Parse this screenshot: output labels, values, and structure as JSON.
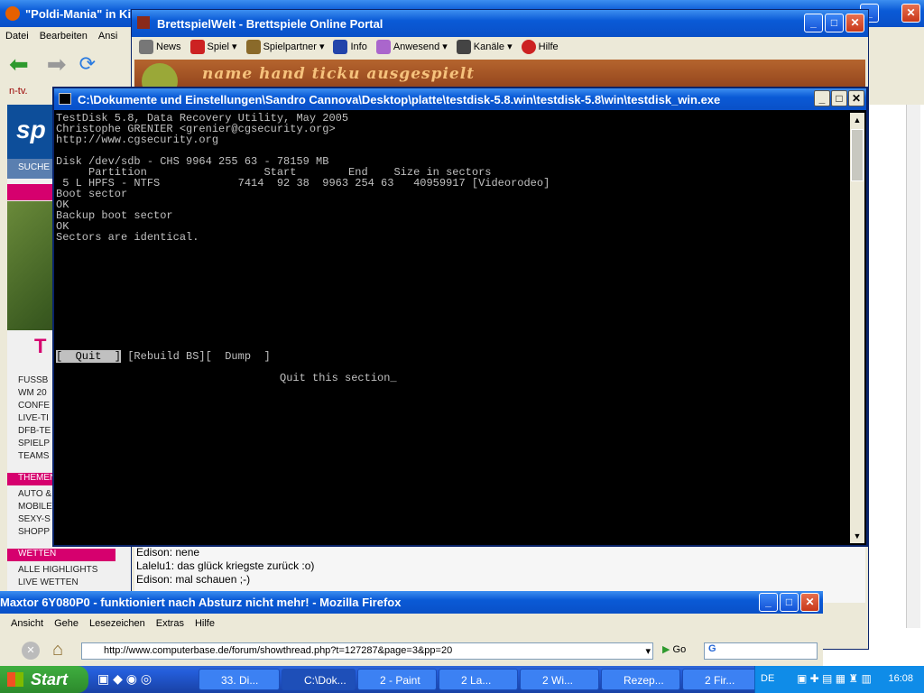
{
  "firefox_back": {
    "title": "\"Poldi-Mania\" in Ki",
    "menu": [
      "Datei",
      "Bearbeiten",
      "Ansi"
    ],
    "bookmark": "n-tv.",
    "sidebar_items": [
      "FUSSB",
      "WM 20",
      "CONFE",
      "LIVE-TI",
      "DFB-TE",
      "SPIELP",
      "TEAMS"
    ],
    "sidebar_themen": "THEMEN",
    "sidebar_items2": [
      "AUTO &",
      "MOBILE",
      "SEXY-S",
      "SHOPP"
    ],
    "wetten": "WETTEN",
    "sidebar_items3": [
      "ALLE HIGHLIGHTS",
      "LIVE WETTEN"
    ],
    "suche": "SUCHE"
  },
  "brettspielwelt": {
    "title": "BrettspielWelt - Brettspiele Online Portal",
    "toolbar": [
      "News",
      "Spiel",
      "Spielpartner",
      "Info",
      "Anwesend",
      "Kanäle",
      "Hilfe"
    ],
    "banner": "name   hand  ticku  ausgespielt",
    "chat": [
      "Edison: nene",
      "Lalelu1: das glück kriegste zurück :o)",
      "Edison: mal schauen ;-)"
    ]
  },
  "testdisk": {
    "title": "C:\\Dokumente und Einstellungen\\Sandro Cannova\\Desktop\\platte\\testdisk-5.8.win\\testdisk-5.8\\win\\testdisk_win.exe",
    "lines": [
      "TestDisk 5.8, Data Recovery Utility, May 2005",
      "Christophe GRENIER <grenier@cgsecurity.org>",
      "http://www.cgsecurity.org",
      "",
      "Disk /dev/sdb - CHS 9964 255 63 - 78159 MB",
      "     Partition                  Start        End    Size in sectors",
      " 5 L HPFS - NTFS            7414  92 38  9963 254 63   40959917 [Videorodeo]",
      "Boot sector",
      "OK",
      "Backup boot sector",
      "OK",
      "Sectors are identical."
    ],
    "menu_quit": "[  Quit  ]",
    "menu_rest": " [Rebuild BS][  Dump  ]",
    "status": "Quit this section_"
  },
  "firefox_front": {
    "title": "Maxtor 6Y080P0 - funktioniert nach Absturz nicht mehr! - Mozilla Firefox",
    "menu": [
      "Ansicht",
      "Gehe",
      "Lesezeichen",
      "Extras",
      "Hilfe"
    ],
    "url": "http://www.computerbase.de/forum/showthread.php?t=127287&page=3&pp=20",
    "go": "Go"
  },
  "taskbar": {
    "start": "Start",
    "tasks": [
      "33. Di...",
      "C:\\Dok...",
      "2 - Paint",
      "2 La...",
      "2 Wi...",
      "Rezep...",
      "2 Fir..."
    ],
    "lang": "DE",
    "clock": "16:08"
  },
  "colors": {
    "xp_title": "#0a5ad6",
    "console_bg": "#000000",
    "console_fg": "#c0c0c0",
    "taskbar": "#245edb",
    "start": "#3fae3f"
  }
}
